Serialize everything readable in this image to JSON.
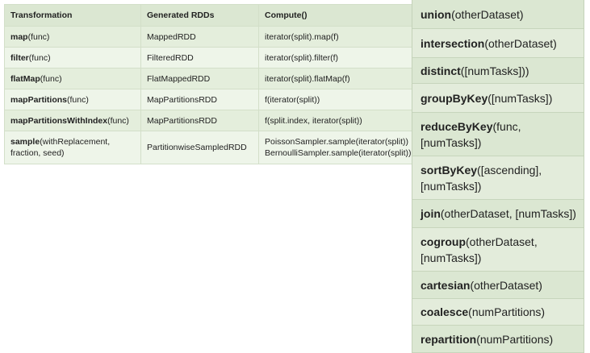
{
  "left_table": {
    "headers": [
      "Transformation",
      "Generated RDDs",
      "Compute()"
    ],
    "rows": [
      {
        "name": "map",
        "params": "(func)",
        "rdd": "MappedRDD",
        "compute": [
          "iterator(split).map(f)"
        ]
      },
      {
        "name": "filter",
        "params": "(func)",
        "rdd": "FilteredRDD",
        "compute": [
          "iterator(split).filter(f)"
        ]
      },
      {
        "name": "flatMap",
        "params": "(func)",
        "rdd": "FlatMappedRDD",
        "compute": [
          "iterator(split).flatMap(f)"
        ]
      },
      {
        "name": "mapPartitions",
        "params": "(func)",
        "rdd": "MapPartitionsRDD",
        "compute": [
          "f(iterator(split))"
        ]
      },
      {
        "name": "mapPartitionsWithIndex",
        "params": "(func)",
        "rdd": "MapPartitionsRDD",
        "compute": [
          "f(split.index, iterator(split))"
        ]
      },
      {
        "name": "sample",
        "params": "(withReplacement,",
        "params2": "fraction, seed)",
        "rdd": "PartitionwiseSampledRDD",
        "compute": [
          "PoissonSampler.sample(iterator(split))",
          "BernoulliSampler.sample(iterator(split))"
        ]
      }
    ]
  },
  "right_list": [
    {
      "name": "union",
      "lines": [
        "(otherDataset)"
      ]
    },
    {
      "name": "intersection",
      "lines": [
        "(otherDataset)"
      ]
    },
    {
      "name": "distinct",
      "lines": [
        "([numTasks]))"
      ]
    },
    {
      "name": "groupByKey",
      "lines": [
        "([numTasks])"
      ]
    },
    {
      "name": "reduceByKey",
      "lines": [
        "(func,",
        "[numTasks])"
      ]
    },
    {
      "name": "sortByKey",
      "lines": [
        "([ascending],",
        "[numTasks])"
      ]
    },
    {
      "name": "join",
      "lines": [
        "(otherDataset, [numTasks])"
      ]
    },
    {
      "name": "cogroup",
      "lines": [
        "(otherDataset,",
        "[numTasks])"
      ]
    },
    {
      "name": "cartesian",
      "lines": [
        "(otherDataset)"
      ]
    },
    {
      "name": "coalesce",
      "lines": [
        "(numPartitions)"
      ]
    },
    {
      "name": "repartition",
      "lines": [
        "(numPartitions)"
      ]
    }
  ]
}
